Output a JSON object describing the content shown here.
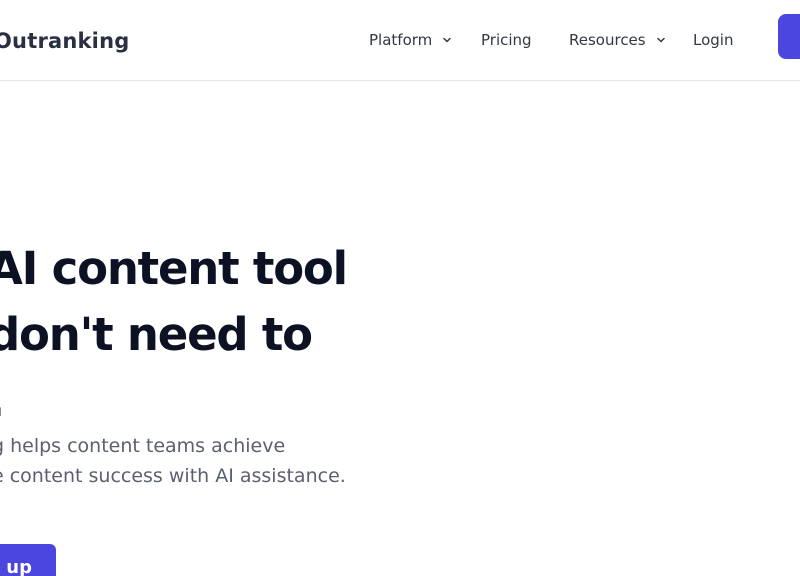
{
  "brand": {
    "name": "Outranking"
  },
  "nav": {
    "items": [
      {
        "label": "Platform",
        "has_dropdown": true
      },
      {
        "label": "Pricing",
        "has_dropdown": false
      },
      {
        "label": "Resources",
        "has_dropdown": true
      },
      {
        "label": "Login",
        "has_dropdown": false
      }
    ],
    "icons": {
      "dropdown": "chevron-down-icon"
    }
  },
  "hero": {
    "title_lines": [
      "AI content tool",
      "don't need to",
      "."
    ],
    "subtitle_lines": [
      "g helps content teams achieve",
      "e content success with AI assistance."
    ],
    "cta_label": "n up"
  },
  "colors": {
    "accent": "#4c46e0",
    "heading": "#0c1124",
    "body": "#5b6070",
    "nav_text": "#333842",
    "border": "#e5e7eb",
    "background": "#ffffff"
  }
}
